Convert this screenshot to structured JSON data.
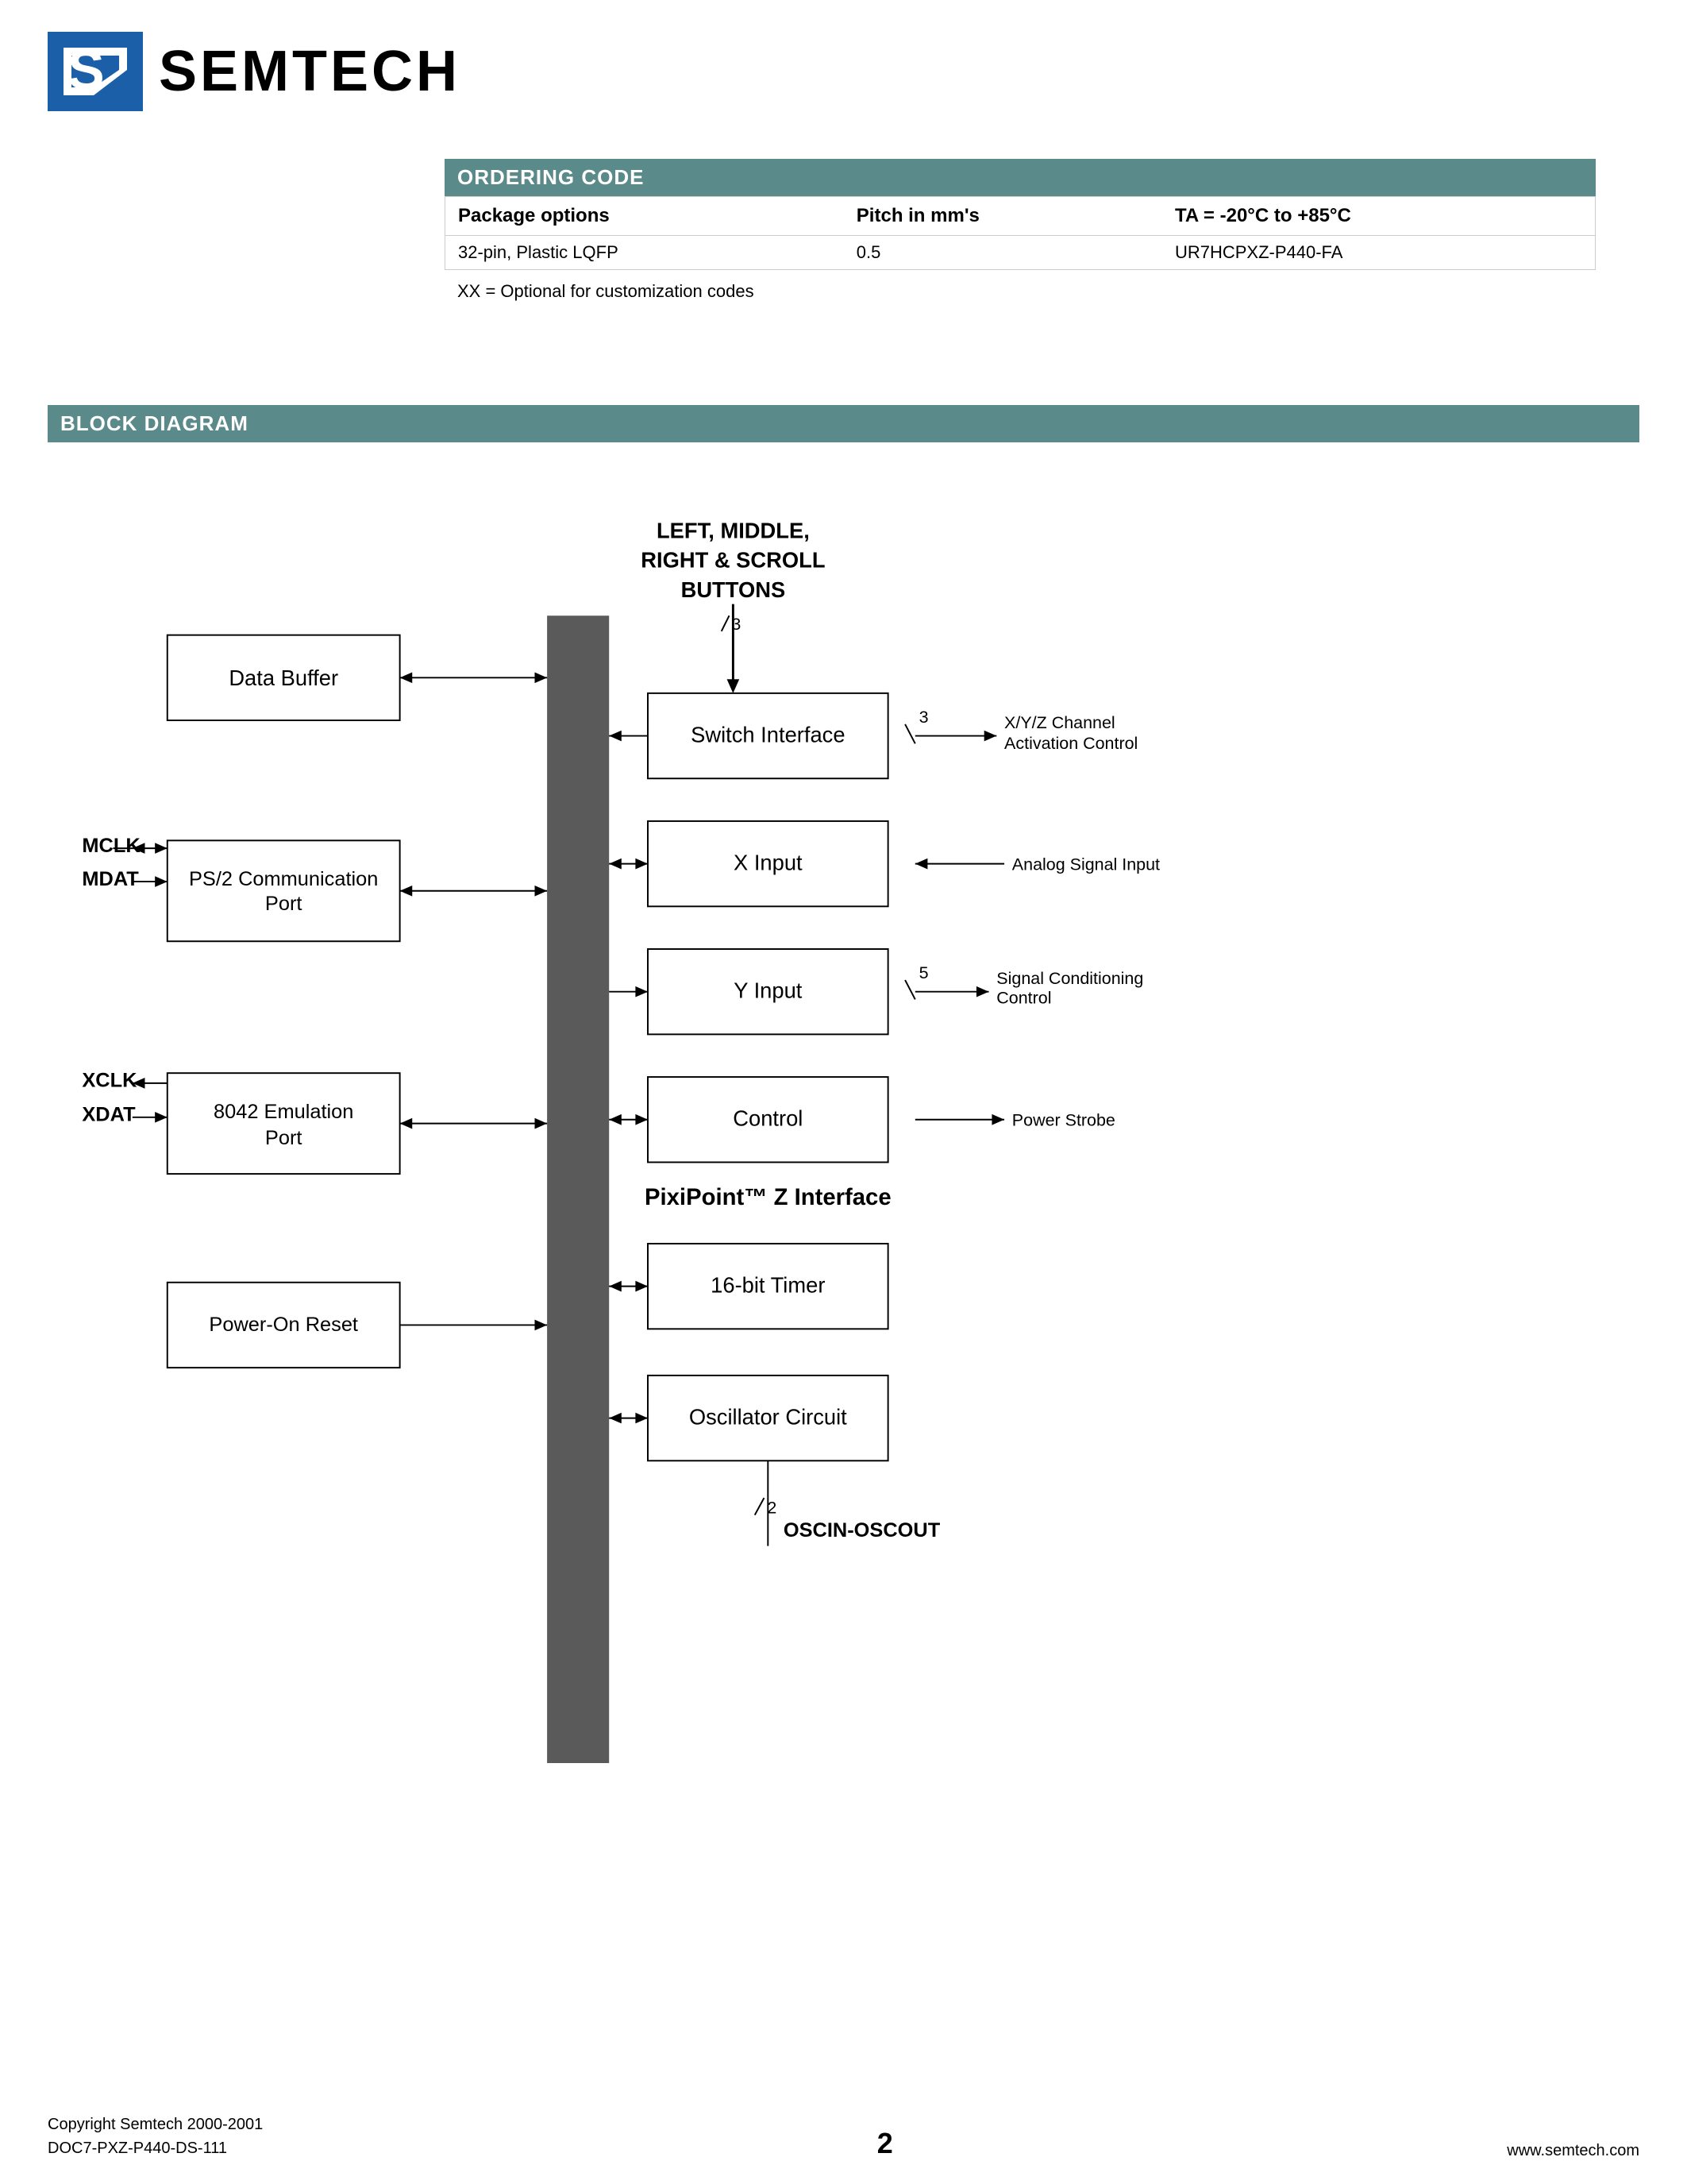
{
  "logo": {
    "company": "SEMTECH"
  },
  "ordering": {
    "header": "ORDERING CODE",
    "columns": [
      "Package options",
      "Pitch in mm's",
      "TA = -20°C to +85°C"
    ],
    "row": [
      "32-pin, Plastic LQFP",
      "0.5",
      "UR7HCPXZ-P440-FA"
    ],
    "note": "XX = Optional for customization codes"
  },
  "block_diagram": {
    "header": "BLOCK DIAGRAM",
    "blocks": {
      "data_buffer": "Data Buffer",
      "ps2_port": "PS/2 Communication Port",
      "emulation_port": "8042 Emulation Port",
      "power_on_reset": "Power-On Reset",
      "switch_interface": "Switch Interface",
      "x_input": "X Input",
      "y_input": "Y Input",
      "control": "Control",
      "timer": "16-bit Timer",
      "oscillator": "Oscillator Circuit",
      "pixipoint": "PixiPoint™ Z Interface"
    },
    "labels": {
      "mclk": "MCLK",
      "mdat": "MDAT",
      "xclk": "XCLK",
      "xdat": "XDAT",
      "buttons": "LEFT, MIDDLE,\nRIGHT & SCROLL\nBUTTONS",
      "xy_channel": "X/Y/Z Channel\nActivation Control",
      "analog_signal": "Analog Signal Input",
      "signal_conditioning": "Signal Conditioning\nControl",
      "power_strobe": "Power Strobe",
      "oscin_oscout": "OSCIN-OSCOUT",
      "num3_buttons": "3",
      "num3_xy": "3",
      "num5": "5",
      "num2": "2"
    }
  },
  "footer": {
    "copyright": "Copyright Semtech 2000-2001",
    "doc_number": "DOC7-PXZ-P440-DS-111",
    "page": "2",
    "website": "www.semtech.com"
  }
}
